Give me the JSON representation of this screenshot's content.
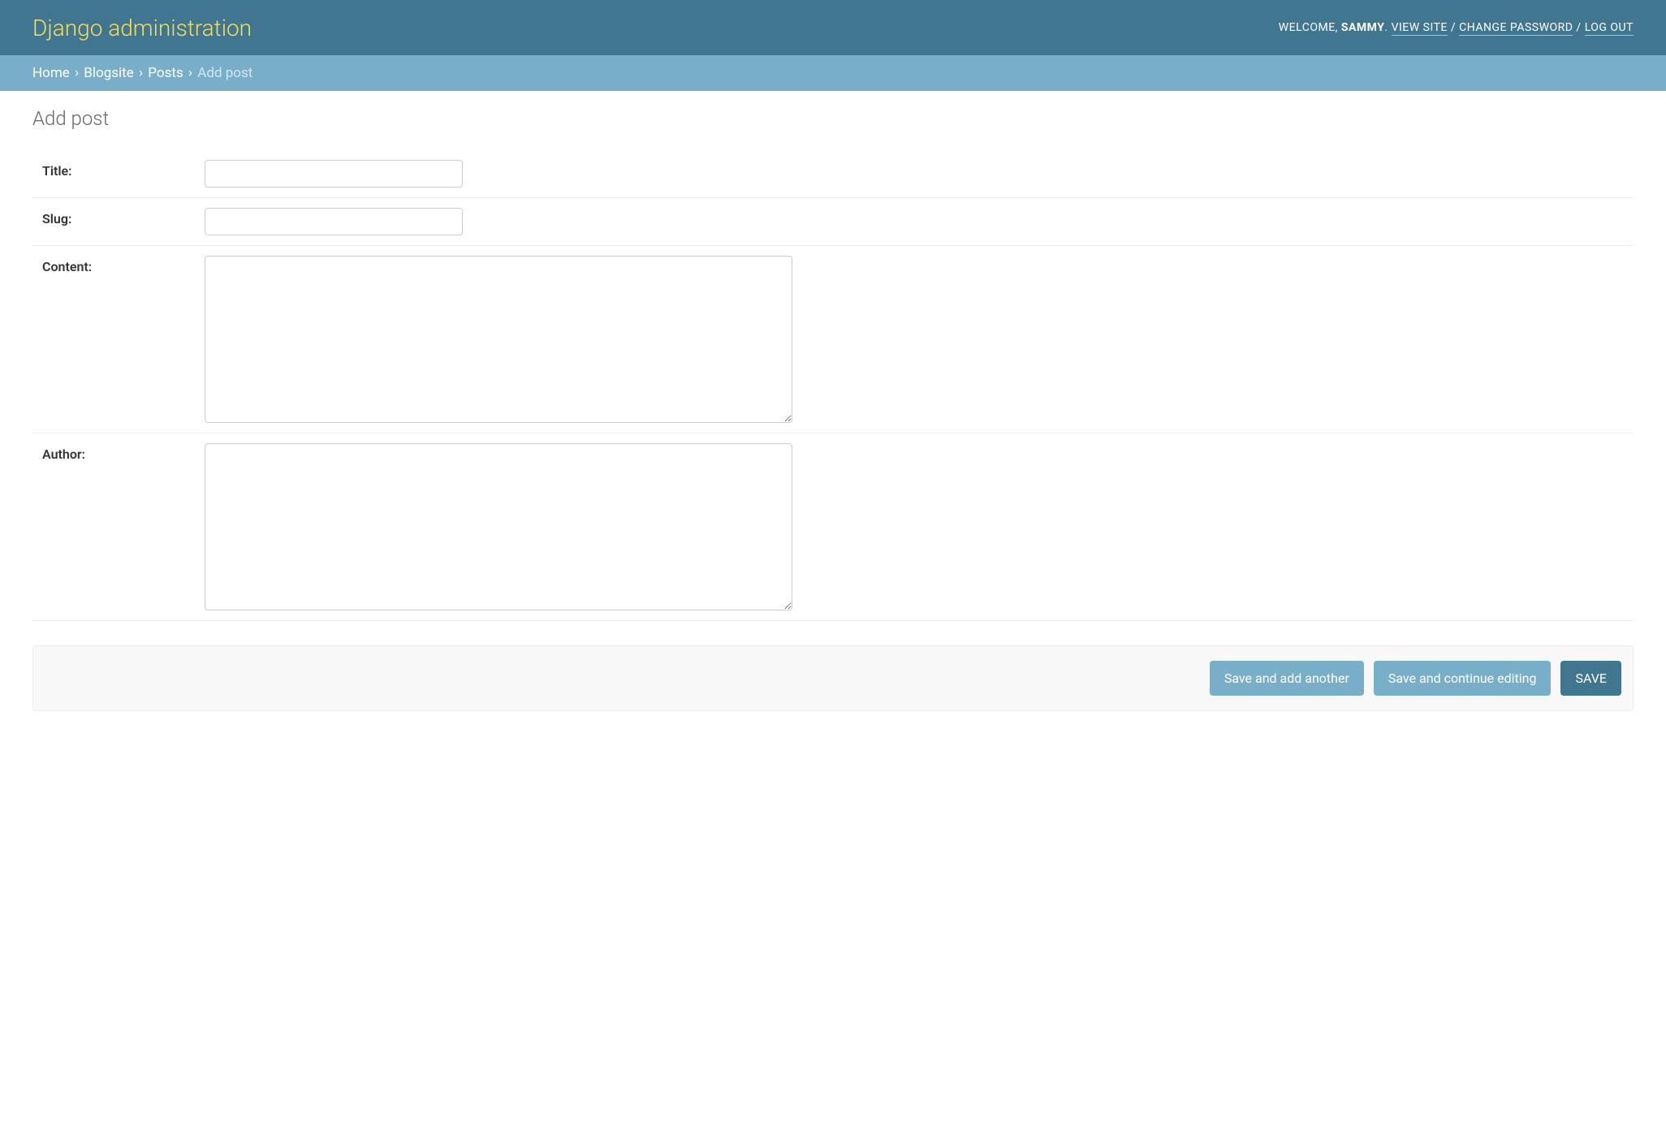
{
  "header": {
    "branding": "Django administration",
    "welcome": "WELCOME, ",
    "username": "SAMMY",
    "dot": ". ",
    "view_site": "VIEW SITE",
    "sep": " / ",
    "change_password": "CHANGE PASSWORD",
    "log_out": "LOG OUT"
  },
  "breadcrumbs": {
    "home": "Home",
    "sep": " › ",
    "app": "Blogsite",
    "model": "Posts",
    "current": "Add post"
  },
  "content": {
    "title": "Add post"
  },
  "form": {
    "title": {
      "label": "Title:",
      "value": ""
    },
    "slug": {
      "label": "Slug:",
      "value": ""
    },
    "content": {
      "label": "Content:",
      "value": ""
    },
    "author": {
      "label": "Author:",
      "value": ""
    }
  },
  "buttons": {
    "save_add_another": "Save and add another",
    "save_continue": "Save and continue editing",
    "save": "SAVE"
  }
}
